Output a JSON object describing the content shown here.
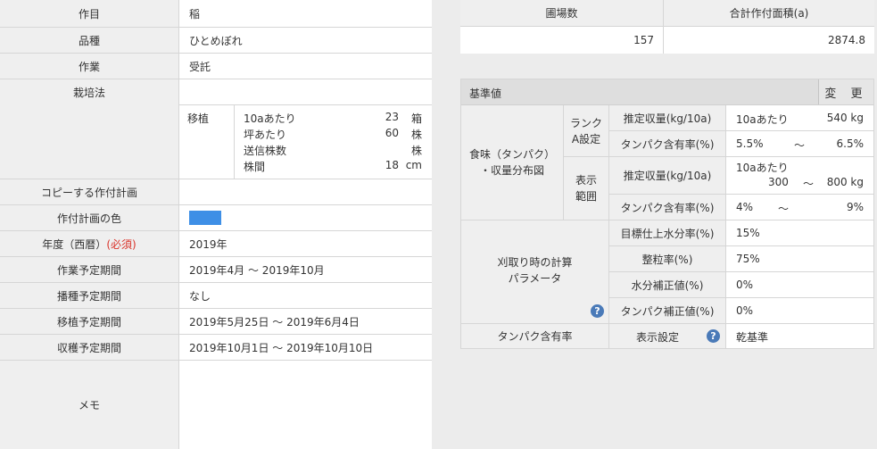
{
  "form": {
    "crop": {
      "label": "作目",
      "value": "稲"
    },
    "variety": {
      "label": "品種",
      "value": "ひとめぼれ"
    },
    "work": {
      "label": "作業",
      "value": "受託"
    },
    "cultivation": {
      "label": "栽培法",
      "kind": "移植",
      "lines": [
        {
          "label": "10aあたり",
          "value": "23",
          "unit": "箱"
        },
        {
          "label": "坪あたり",
          "value": "60",
          "unit": "株"
        },
        {
          "label": "送信株数",
          "value": "",
          "unit": "株"
        },
        {
          "label": "株間",
          "value": "18",
          "unit": "cm"
        }
      ]
    },
    "copy_plan": {
      "label": "コピーする作付計画",
      "value": ""
    },
    "plan_color": {
      "label": "作付計画の色",
      "color": "#3e8fe6"
    },
    "year": {
      "label": "年度（西暦）",
      "required": "(必須)",
      "value": "2019年"
    },
    "work_period": {
      "label": "作業予定期間",
      "value": "2019年4月 ～ 2019年10月"
    },
    "sowing_period": {
      "label": "播種予定期間",
      "value": "なし"
    },
    "transplant_period": {
      "label": "移植予定期間",
      "value": "2019年5月25日 ～ 2019年6月4日"
    },
    "harvest_period": {
      "label": "収穫予定期間",
      "value": "2019年10月1日 ～ 2019年10月10日"
    },
    "memo": {
      "label": "メモ",
      "value": ""
    }
  },
  "summary": {
    "fields_header": "圃場数",
    "area_header": "合計作付面積(a)",
    "fields_value": "157",
    "area_value": "2874.8"
  },
  "standard": {
    "title": "基準値",
    "change_label": "変 更",
    "taste_group": "食味（タンパク）\n・収量分布図",
    "rank_group": "ランク\nA設定",
    "display_group": "表示\n範囲",
    "rows": {
      "rank_yield_label": "推定収量(kg/10a)",
      "rank_yield_prefix": "10aあたり",
      "rank_yield_value": "540 kg",
      "rank_protein_label": "タンパク含有率(%)",
      "rank_protein_from": "5.5%",
      "rank_protein_sep": "～",
      "rank_protein_to": "6.5%",
      "disp_yield_label": "推定収量(kg/10a)",
      "disp_yield_prefix": "10aあたり",
      "disp_yield_from": "300",
      "disp_yield_sep": "～",
      "disp_yield_to": "800 kg",
      "disp_protein_label": "タンパク含有率(%)",
      "disp_protein_from": "4%",
      "disp_protein_sep": "～",
      "disp_protein_to": "9%"
    },
    "harvest_group": "刈取り時の計算\nパラメータ",
    "params": [
      {
        "label": "目標仕上水分率(%)",
        "value": "15%"
      },
      {
        "label": "整粒率(%)",
        "value": "75%"
      },
      {
        "label": "水分補正値(%)",
        "value": "0%"
      },
      {
        "label": "タンパク補正値(%)",
        "value": "0%"
      }
    ],
    "protein_label": "タンパク含有率",
    "display_setting_label": "表示設定",
    "display_setting_value": "乾基準",
    "help_icon_glyph": "?"
  }
}
